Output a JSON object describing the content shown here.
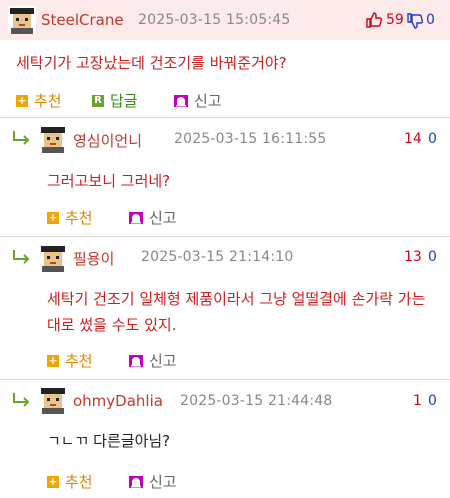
{
  "post": {
    "author": "SteelCrane",
    "timestamp": "2025-03-15 15:05:45",
    "upvotes": "59",
    "downvotes": "0",
    "text": "세탁기가 고장났는데 건조기를 바꿔준거야?",
    "actions": {
      "recommend": "추천",
      "reply": "답글",
      "report": "신고"
    }
  },
  "comments": [
    {
      "author": "영심이언니",
      "timestamp": "2025-03-15 16:11:55",
      "upvotes": "14",
      "downvotes": "0",
      "text": "그러고보니 그러네?",
      "actions": {
        "recommend": "추천",
        "report": "신고"
      }
    },
    {
      "author": "필용이",
      "timestamp": "2025-03-15 21:14:10",
      "upvotes": "13",
      "downvotes": "0",
      "text": "세탁기 건조기 일체형 제품이라서 그냥 얼떨결에 손가락 가는 대로 썼을 수도 있지.",
      "actions": {
        "recommend": "추천",
        "report": "신고"
      }
    },
    {
      "author": "ohmyDahlia",
      "timestamp": "2025-03-15 21:44:48",
      "upvotes": "1",
      "downvotes": "0",
      "text": "ㄱㄴㄲ 다른글아님?",
      "actions": {
        "recommend": "추천",
        "report": "신고"
      }
    }
  ],
  "colors": {
    "author": "#c0392b",
    "body_text": "#cc1f1f",
    "upvote": "#d0021b",
    "downvote": "#1f3fbf",
    "header_bg": "#fdeaea",
    "recommend": "#d98a00",
    "reply": "#3a8a1a"
  }
}
